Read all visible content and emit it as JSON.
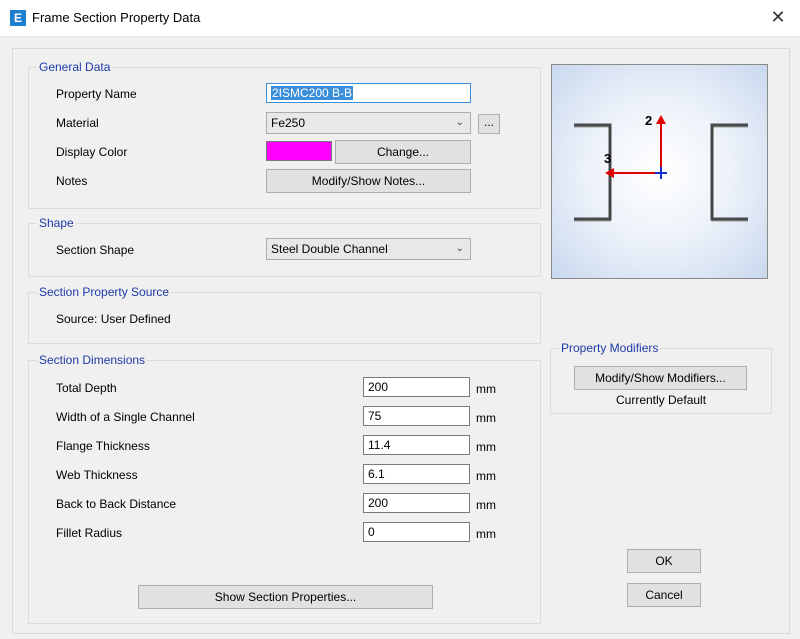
{
  "window": {
    "title": "Frame Section Property Data",
    "app_icon": "E",
    "close": "✕"
  },
  "general": {
    "title": "General Data",
    "property_name_label": "Property Name",
    "property_name_value": "2ISMC200 B-B",
    "material_label": "Material",
    "material_value": "Fe250",
    "material_more": "...",
    "display_color_label": "Display Color",
    "display_color": "#ff00ff",
    "change_label": "Change...",
    "notes_label": "Notes",
    "notes_button": "Modify/Show Notes..."
  },
  "shape": {
    "title": "Shape",
    "section_shape_label": "Section Shape",
    "section_shape_value": "Steel Double Channel"
  },
  "source": {
    "title": "Section Property Source",
    "text": "Source:  User Defined"
  },
  "dimensions": {
    "title": "Section Dimensions",
    "rows": [
      {
        "label": "Total Depth",
        "value": "200",
        "unit": "mm"
      },
      {
        "label": "Width of a Single Channel",
        "value": "75",
        "unit": "mm"
      },
      {
        "label": "Flange Thickness",
        "value": "11.4",
        "unit": "mm"
      },
      {
        "label": "Web Thickness",
        "value": "6.1",
        "unit": "mm"
      },
      {
        "label": "Back to Back Distance",
        "value": "200",
        "unit": "mm"
      },
      {
        "label": "Fillet Radius",
        "value": "0",
        "unit": "mm"
      }
    ]
  },
  "preview": {
    "axis2": "2",
    "axis3": "3"
  },
  "modifiers": {
    "title": "Property Modifiers",
    "button": "Modify/Show Modifiers...",
    "status": "Currently Default"
  },
  "actions": {
    "show_props": "Show Section Properties...",
    "ok": "OK",
    "cancel": "Cancel"
  },
  "colors": {
    "group_title": "#1e3aa8",
    "accent": "#3a8fd8"
  }
}
